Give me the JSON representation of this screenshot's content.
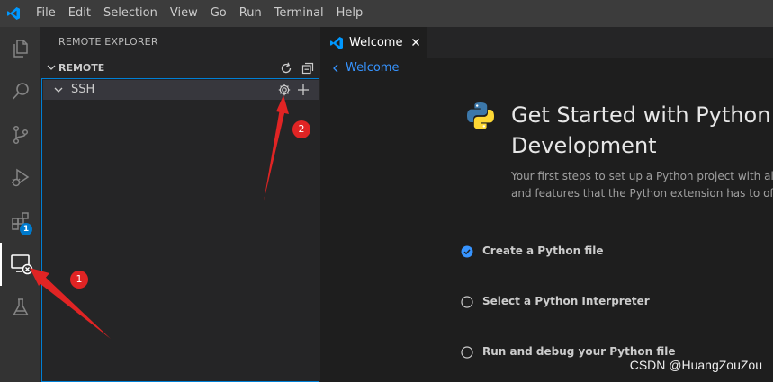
{
  "menu": {
    "items": [
      "File",
      "Edit",
      "Selection",
      "View",
      "Go",
      "Run",
      "Terminal",
      "Help"
    ]
  },
  "activity_bar": {
    "items": [
      {
        "icon": "explorer-icon"
      },
      {
        "icon": "search-icon"
      },
      {
        "icon": "source-control-icon"
      },
      {
        "icon": "run-debug-icon"
      },
      {
        "icon": "extensions-icon",
        "badge": "1"
      },
      {
        "icon": "remote-explorer-icon",
        "active": true
      },
      {
        "icon": "testing-icon"
      }
    ]
  },
  "sidebar": {
    "title": "REMOTE EXPLORER",
    "section": {
      "label": "REMOTE",
      "actions": [
        "refresh-icon",
        "collapse-all-icon"
      ]
    },
    "tree": {
      "label": "SSH",
      "actions": [
        "gear-icon",
        "plus-icon"
      ]
    }
  },
  "editor": {
    "tab": {
      "label": "Welcome"
    },
    "breadcrumb": {
      "label": "Welcome"
    },
    "walkthrough": {
      "title": "Get Started with Python Development",
      "description_line1": "Your first steps to set up a Python project with all th",
      "description_line2": "and features that the Python extension has to offer",
      "steps": [
        {
          "label": "Create a Python file",
          "done": true
        },
        {
          "label": "Select a Python Interpreter",
          "done": false
        },
        {
          "label": "Run and debug your Python file",
          "done": false
        }
      ]
    }
  },
  "annotations": {
    "markers": [
      "1",
      "2"
    ],
    "arrow_color": "#e02424",
    "watermark": "CSDN @HuangZouZou"
  },
  "colors": {
    "accent": "#007acc",
    "link": "#3794ff",
    "focus_border": "#007fd4"
  }
}
